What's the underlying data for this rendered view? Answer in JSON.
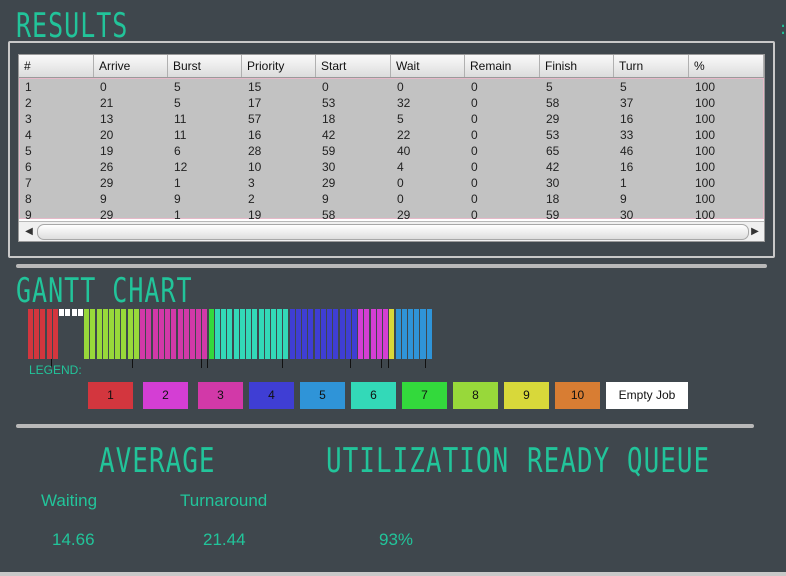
{
  "results": {
    "title": "RESULTS",
    "columns": [
      "#",
      "Arrive",
      "Burst",
      "Priority",
      "Start",
      "Wait",
      "Remain",
      "Finish",
      "Turn",
      "%"
    ],
    "rows": [
      [
        "1",
        "0",
        "5",
        "15",
        "0",
        "0",
        "0",
        "5",
        "5",
        "100"
      ],
      [
        "2",
        "21",
        "5",
        "17",
        "53",
        "32",
        "0",
        "58",
        "37",
        "100"
      ],
      [
        "3",
        "13",
        "11",
        "57",
        "18",
        "5",
        "0",
        "29",
        "16",
        "100"
      ],
      [
        "4",
        "20",
        "11",
        "16",
        "42",
        "22",
        "0",
        "53",
        "33",
        "100"
      ],
      [
        "5",
        "19",
        "6",
        "28",
        "59",
        "40",
        "0",
        "65",
        "46",
        "100"
      ],
      [
        "6",
        "26",
        "12",
        "10",
        "30",
        "4",
        "0",
        "42",
        "16",
        "100"
      ],
      [
        "7",
        "29",
        "1",
        "3",
        "29",
        "0",
        "0",
        "30",
        "1",
        "100"
      ],
      [
        "8",
        "9",
        "9",
        "2",
        "9",
        "0",
        "0",
        "18",
        "9",
        "100"
      ],
      [
        "9",
        "29",
        "1",
        "19",
        "58",
        "29",
        "0",
        "59",
        "30",
        "100"
      ]
    ]
  },
  "gantt": {
    "title": "GANTT CHART",
    "legend_label": "LEGEND:",
    "empty_job_label": "Empty Job",
    "legend": [
      {
        "label": "1",
        "color": "#d3363e"
      },
      {
        "label": "2",
        "color": "#d43ed4"
      },
      {
        "label": "3",
        "color": "#d239a8"
      },
      {
        "label": "4",
        "color": "#3f3ed4"
      },
      {
        "label": "5",
        "color": "#2f94d8"
      },
      {
        "label": "6",
        "color": "#33d9b8"
      },
      {
        "label": "7",
        "color": "#33d93c"
      },
      {
        "label": "8",
        "color": "#98d83a"
      },
      {
        "label": "9",
        "color": "#d8d83a"
      },
      {
        "label": "10",
        "color": "#d87d33"
      }
    ],
    "schedule": [
      {
        "job": "1",
        "start": 0,
        "end": 5
      },
      {
        "job": "idle",
        "start": 5,
        "end": 9
      },
      {
        "job": "8",
        "start": 9,
        "end": 18
      },
      {
        "job": "3",
        "start": 18,
        "end": 29
      },
      {
        "job": "7",
        "start": 29,
        "end": 30
      },
      {
        "job": "6",
        "start": 30,
        "end": 42
      },
      {
        "job": "4",
        "start": 42,
        "end": 53
      },
      {
        "job": "2",
        "start": 53,
        "end": 58
      },
      {
        "job": "9",
        "start": 58,
        "end": 59
      },
      {
        "job": "5",
        "start": 59,
        "end": 65
      }
    ]
  },
  "summary": {
    "average_title": "AVERAGE",
    "utilization_title": "UTILIZATION",
    "ready_queue_title": "READY QUEUE",
    "waiting_label": "Waiting",
    "turnaround_label": "Turnaround",
    "waiting_value": "14.66",
    "turnaround_value": "21.44",
    "utilization_value": "93%"
  }
}
